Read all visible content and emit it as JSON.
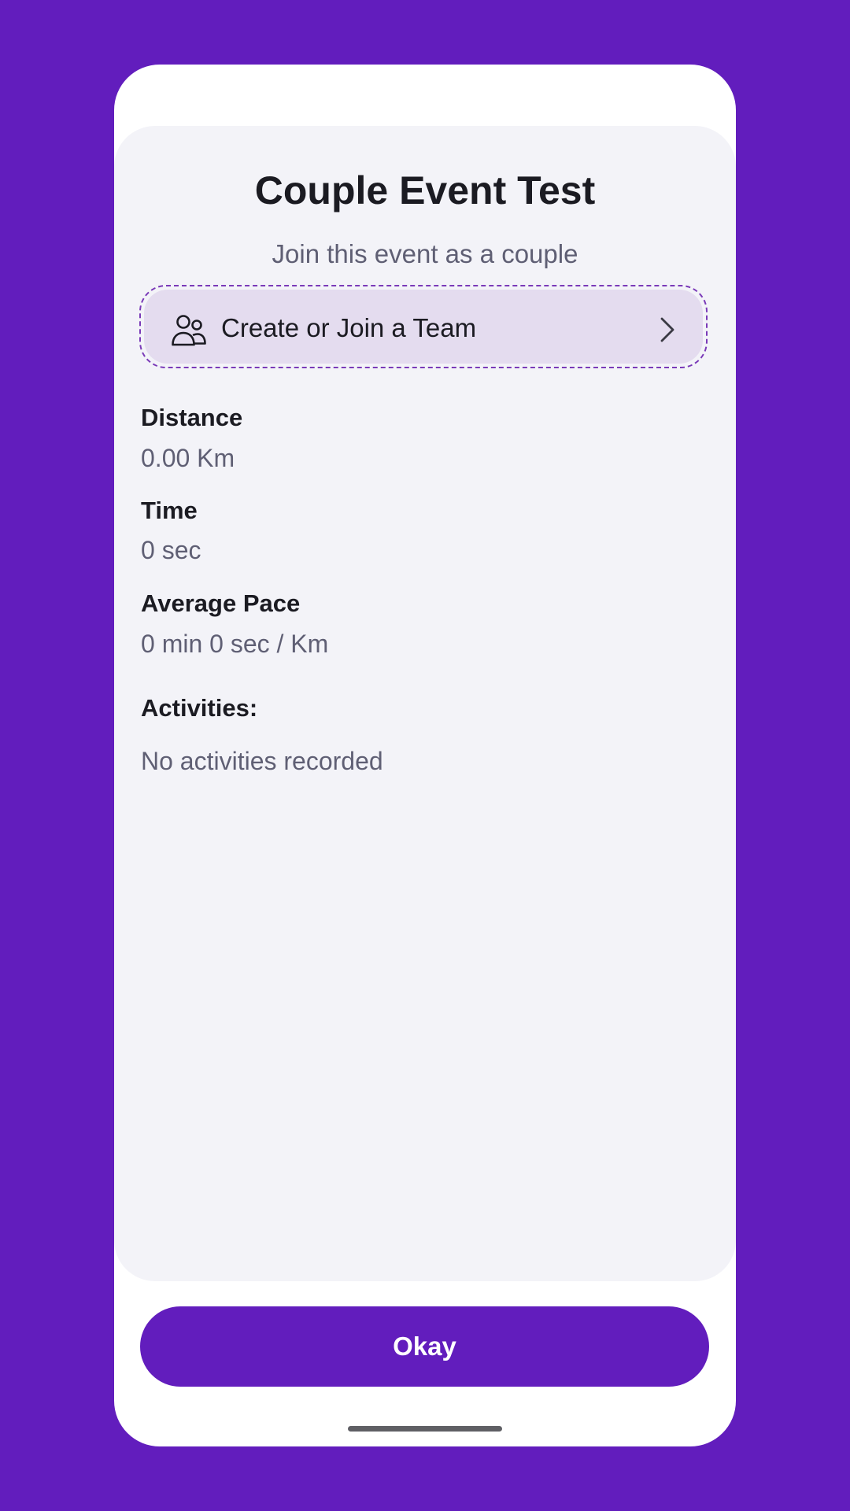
{
  "event": {
    "title": "Couple Event Test",
    "subtitle": "Join this event as a couple"
  },
  "team_button": {
    "label": "Create or Join a Team",
    "icon": "people-icon",
    "trailing_icon": "chevron-right-icon"
  },
  "stats": {
    "distance": {
      "label": "Distance",
      "value": "0.00 Km"
    },
    "time": {
      "label": "Time",
      "value": "0 sec"
    },
    "pace": {
      "label": "Average Pace",
      "value": "0 min 0 sec / Km"
    }
  },
  "activities": {
    "heading": "Activities:",
    "empty_text": "No activities recorded"
  },
  "actions": {
    "okay_label": "Okay"
  },
  "colors": {
    "background": "#621dbd",
    "accent": "#621dbd",
    "card": "#f3f3f8",
    "team_button_fill": "#e4dcef",
    "dashed_border": "#7a3ab8"
  }
}
